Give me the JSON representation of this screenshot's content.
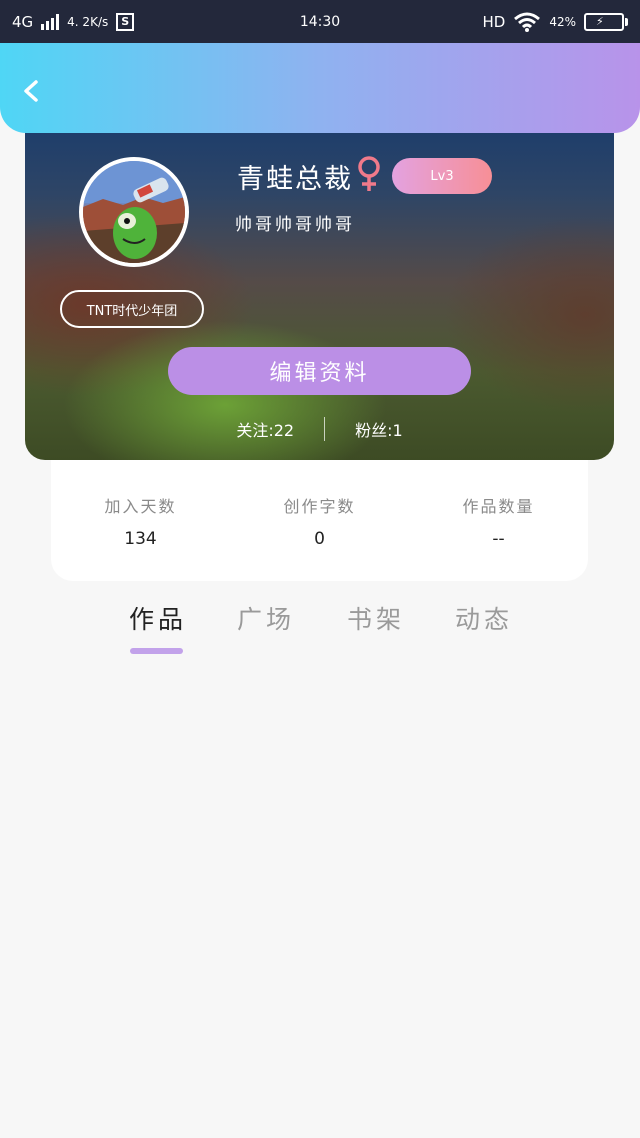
{
  "status_bar": {
    "network": "4G",
    "speed": "4. 2K/s",
    "s_badge": "S",
    "time": "14:30",
    "hd": "HD",
    "battery_percent": "42%",
    "battery_level": 0.42
  },
  "profile": {
    "username": "青蛙总裁",
    "gender_icon": "female-icon",
    "level": "Lv3",
    "signature": "帅哥帅哥帅哥",
    "group_tag": "TNT时代少年团",
    "edit_button": "编辑资料",
    "following": "关注:22",
    "followers": "粉丝:1"
  },
  "stats": [
    {
      "label": "加入天数",
      "value": "134"
    },
    {
      "label": "创作字数",
      "value": "0"
    },
    {
      "label": "作品数量",
      "value": "--"
    }
  ],
  "tabs": [
    {
      "label": "作品",
      "active": true
    },
    {
      "label": "广场",
      "active": false
    },
    {
      "label": "书架",
      "active": false
    },
    {
      "label": "动态",
      "active": false
    }
  ],
  "colors": {
    "header_gradient": [
      "#4fd6f5",
      "#b893ea"
    ],
    "edit_button": "#bb8fe6",
    "level_badge": [
      "#e3a2e0",
      "#f78f96"
    ],
    "female_icon": "#f07a8a",
    "tab_underline": "#c2a2ea"
  }
}
